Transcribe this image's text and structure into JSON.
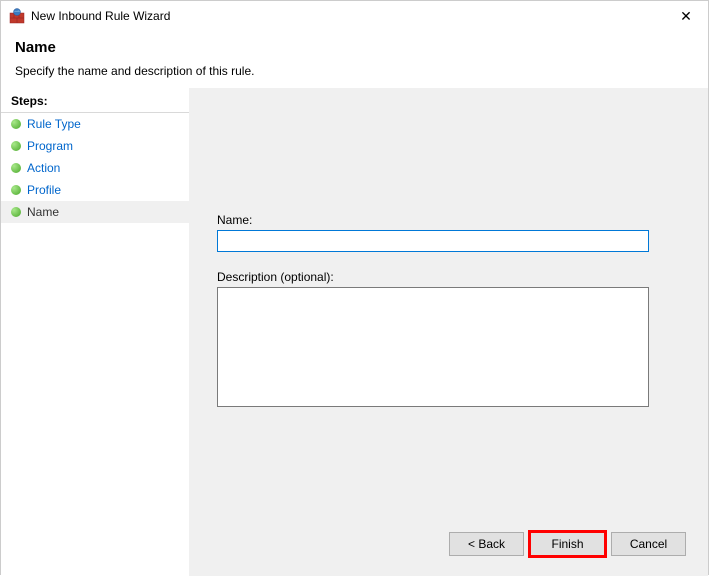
{
  "window": {
    "title": "New Inbound Rule Wizard",
    "close": "✕"
  },
  "header": {
    "title": "Name",
    "description": "Specify the name and description of this rule."
  },
  "steps": {
    "title": "Steps:",
    "items": [
      {
        "label": "Rule Type"
      },
      {
        "label": "Program"
      },
      {
        "label": "Action"
      },
      {
        "label": "Profile"
      },
      {
        "label": "Name"
      }
    ]
  },
  "form": {
    "name_label": "Name:",
    "name_value": "",
    "desc_label": "Description (optional):",
    "desc_value": ""
  },
  "buttons": {
    "back": "< Back",
    "finish": "Finish",
    "cancel": "Cancel"
  }
}
